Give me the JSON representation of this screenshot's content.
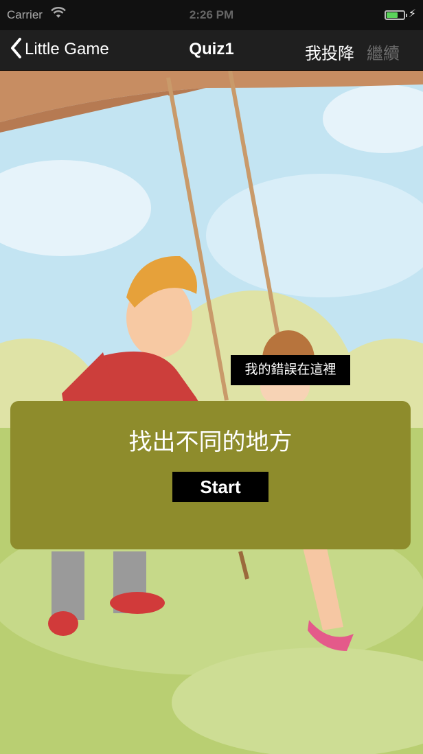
{
  "status_bar": {
    "carrier": "Carrier",
    "time": "2:26 PM",
    "wifi_icon": "wifi-icon",
    "battery_icon": "battery-icon"
  },
  "nav": {
    "back_label": "Little Game",
    "back_icon": "chevron-left-icon",
    "title": "Quiz1",
    "give_up_label": "我投降",
    "continue_label": "繼續"
  },
  "scene": {
    "hint_label": "我的錯誤在這裡"
  },
  "panel": {
    "title": "找出不同的地方",
    "start_label": "Start"
  },
  "colors": {
    "panel": "#8e8c2c",
    "nav_bar": "#1f1f1f",
    "sky": "#bfe3f2",
    "grass": "#b9cf72"
  }
}
